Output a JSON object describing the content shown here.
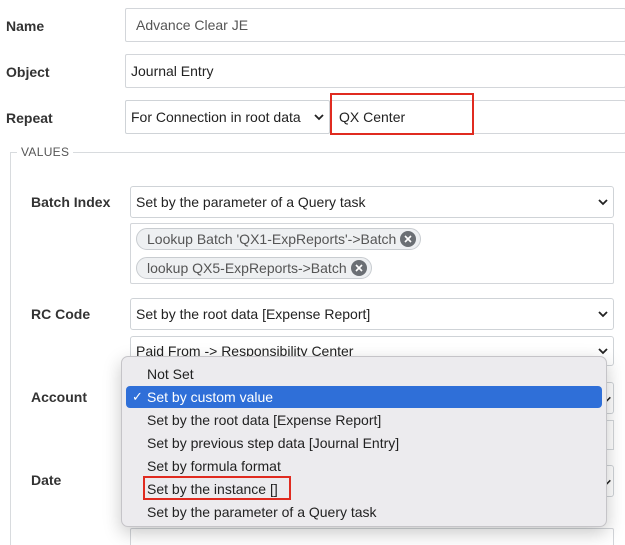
{
  "form": {
    "name_label": "Name",
    "name_value": "Advance Clear JE",
    "object_label": "Object",
    "object_value": "Journal Entry",
    "repeat_label": "Repeat",
    "repeat_select": "For Connection in root data",
    "repeat_value": "QX Center"
  },
  "values": {
    "legend": "VALUES",
    "batch_index_label": "Batch Index",
    "batch_index_select": "Set by the parameter of a Query task",
    "batch_tags": [
      "Lookup Batch 'QX1-ExpReports'->Batch",
      "lookup QX5-ExpReports->Batch"
    ],
    "rc_code_label": "RC Code",
    "rc_code_select": "Set by the root data [Expense Report]",
    "rc_code_sub_select": "Paid From -> Responsibility Center",
    "account_label": "Account",
    "date_label": "Date"
  },
  "dropdown": {
    "options": [
      "Not Set",
      "Set by custom value",
      "Set by the root data [Expense Report]",
      "Set by previous step data [Journal Entry]",
      "Set by formula format",
      "Set by the instance []",
      "Set by the parameter of a Query task"
    ],
    "selected_index": 1,
    "check_glyph": "✓"
  },
  "colors": {
    "highlight": "#e02b20",
    "selection": "#2f6fd8"
  }
}
